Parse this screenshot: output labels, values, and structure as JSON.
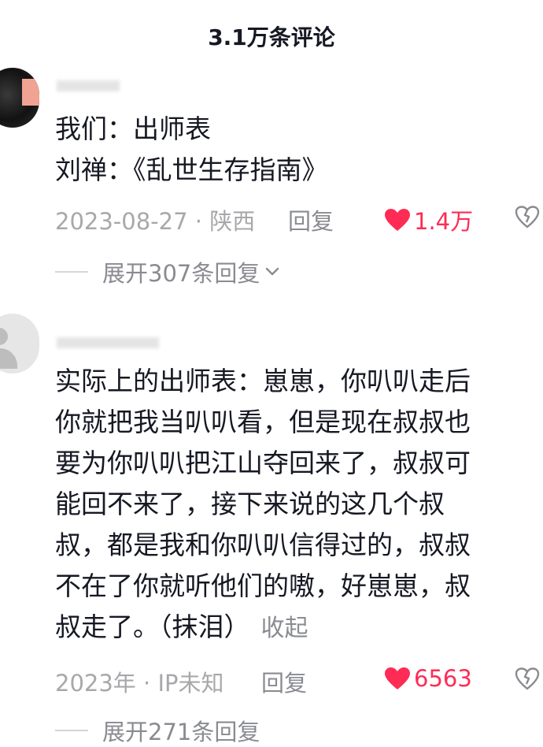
{
  "header": {
    "title": "3.1万条评论"
  },
  "comments": [
    {
      "text_lines": [
        "我们：出师表",
        "刘禅：《乱世生存指南》"
      ],
      "date": "2023-08-27 · 陕西",
      "reply_label": "回复",
      "likes": "1.4万",
      "expand_label": "展开307条回复"
    },
    {
      "text_lines": [
        "实际上的出师表：崽崽，你叭叭走后",
        "你就把我当叭叭看，但是现在叔叔也",
        "要为你叭叭把江山夺回来了，叔叔可",
        "能回不来了，接下来说的这几个叔",
        "叔，都是我和你叭叭信得过的，叔叔",
        "不在了你就听他们的嗷，好崽崽，叔",
        "叔走了。（抹泪）"
      ],
      "collapse_label": "收起",
      "date": "2023年 · IP未知",
      "reply_label": "回复",
      "likes": "6563",
      "expand_label": "展开271条回复"
    }
  ],
  "colors": {
    "like_red": "#fe2c55",
    "meta_gray": "#a8a8ab",
    "text": "#161823"
  },
  "icons": [
    "heart-icon",
    "dislike-icon",
    "chevron-down-icon"
  ]
}
